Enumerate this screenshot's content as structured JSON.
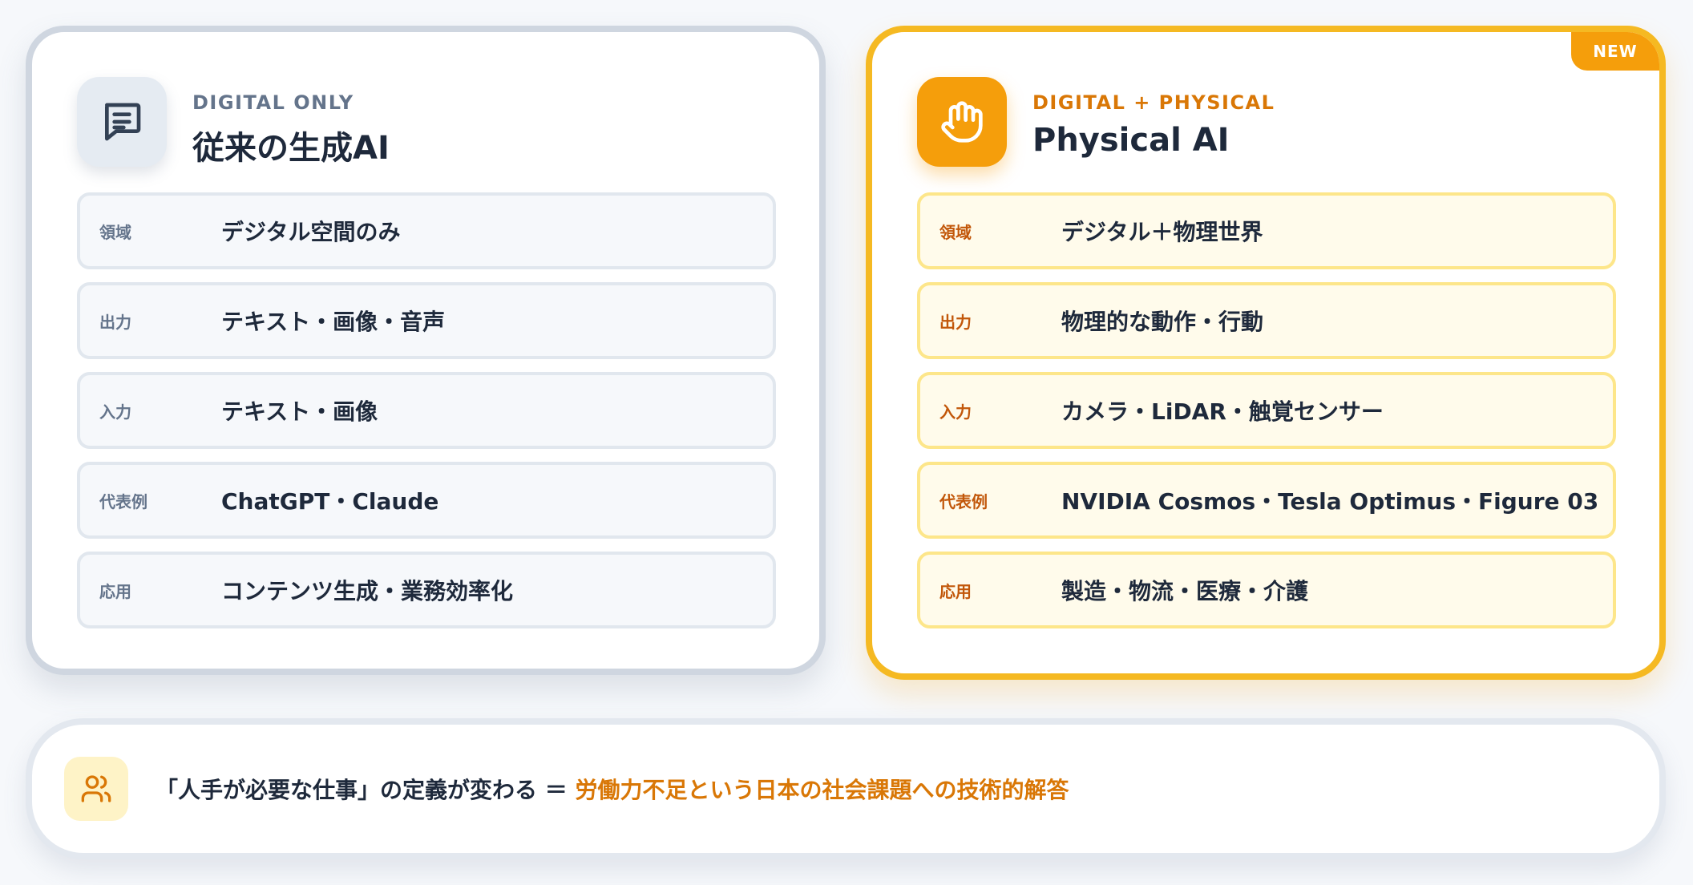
{
  "colors": {
    "accent": "#f59e0b",
    "accent_text": "#d97706",
    "neutral_border": "#cfd6e0",
    "text_dark": "#1e293b",
    "text_muted": "#64748b"
  },
  "left_card": {
    "eyebrow": "DIGITAL ONLY",
    "title": "従来の生成AI",
    "icon": "message-square-icon",
    "rows": [
      {
        "label": "領域",
        "value": "デジタル空間のみ"
      },
      {
        "label": "出力",
        "value": "テキスト・画像・音声"
      },
      {
        "label": "入力",
        "value": "テキスト・画像"
      },
      {
        "label": "代表例",
        "value": "ChatGPT・Claude"
      },
      {
        "label": "応用",
        "value": "コンテンツ生成・業務効率化"
      }
    ]
  },
  "right_card": {
    "badge": "NEW",
    "eyebrow": "DIGITAL + PHYSICAL",
    "title": "Physical AI",
    "icon": "hand-icon",
    "rows": [
      {
        "label": "領域",
        "value": "デジタル＋物理世界"
      },
      {
        "label": "出力",
        "value": "物理的な動作・行動"
      },
      {
        "label": "入力",
        "value": "カメラ・LiDAR・触覚センサー"
      },
      {
        "label": "代表例",
        "value": "NVIDIA Cosmos・Tesla Optimus・Figure 03"
      },
      {
        "label": "応用",
        "value": "製造・物流・医療・介護"
      }
    ]
  },
  "banner": {
    "icon": "users-icon",
    "text_main": "「人手が必要な仕事」の定義が変わる",
    "equals": " ＝ ",
    "text_highlight": "労働力不足という日本の社会課題への技術的解答"
  }
}
